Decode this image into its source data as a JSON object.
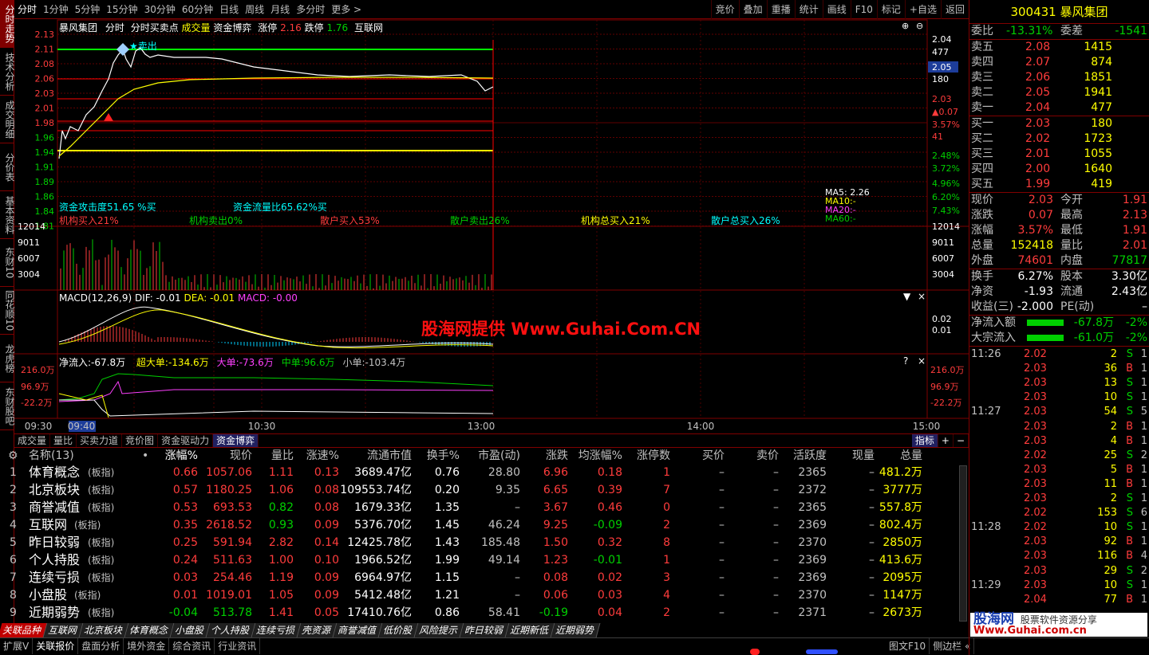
{
  "left_tabs": [
    "分时走势",
    "技术分析",
    "成交明细",
    "分价表",
    "基本资料",
    "东财10",
    "同花顺10",
    "龙虎榜",
    "东财股吧"
  ],
  "top_periods": [
    "分时",
    "1分钟",
    "5分钟",
    "15分钟",
    "30分钟",
    "60分钟",
    "日线",
    "周线",
    "月线",
    "多分时",
    "更多 >"
  ],
  "top_tools": [
    "竞价",
    "叠加",
    "重播",
    "统计",
    "画线",
    "F10",
    "标记",
    "+自选",
    "返回"
  ],
  "chart": {
    "header": {
      "name": "暴风集团",
      "items": [
        "分时",
        "分时买卖点",
        "成交量",
        "资金博弈"
      ],
      "zt_label": "涨停",
      "zt": "2.16",
      "dt_label": "跌停",
      "dt": "1.76",
      "industry": "互联网"
    },
    "y_left": [
      "2.13",
      "2.11",
      "2.08",
      "2.06",
      "2.03",
      "2.01",
      "1.98",
      "1.96",
      "1.94",
      "1.91",
      "1.89",
      "1.86",
      "1.84",
      "1.81"
    ],
    "y_right": [
      "2.04",
      "477",
      "2.05",
      "180",
      "2.03",
      "▲0.07",
      "3.57%",
      "41",
      "2.48%",
      "3.72%",
      "4.96%",
      "6.20%",
      "7.43%"
    ],
    "sell_tag": "卖出",
    "flow_text1": "资金攻击度51.65 %买",
    "flow_text2": "资金流量比65.62%买",
    "inst": [
      {
        "t": "机构买入21%",
        "c": "#ff3c3c"
      },
      {
        "t": "机构卖出0%",
        "c": "#00d000"
      },
      {
        "t": "散户买入53%",
        "c": "#ff3c3c"
      },
      {
        "t": "散户卖出26%",
        "c": "#00d000"
      },
      {
        "t": "机构总买入21%",
        "c": "#ffff00"
      },
      {
        "t": "散户总买入26%",
        "c": "#00ffff"
      }
    ],
    "ma": {
      "ma5": "MA5:  2.26",
      "ma10": "MA10:-",
      "ma20": "MA20:-",
      "ma60": "MA60:-"
    },
    "vol_y": [
      "12014",
      "9011",
      "6007",
      "3004"
    ],
    "macd_label": "MACD(12,26,9)",
    "dif": "DIF: -0.01",
    "dea": "DEA: -0.01",
    "macd": "MACD: -0.00",
    "macd_y": [
      "0.02",
      "0.01"
    ],
    "flow_label": "净流入:-67.8万",
    "flow_items": [
      {
        "t": "超大单:-134.6万",
        "c": "#ffff00"
      },
      {
        "t": "大单:-73.6万",
        "c": "#ff40ff"
      },
      {
        "t": "中单:96.6万",
        "c": "#00d000"
      },
      {
        "t": "小单:-103.4万",
        "c": "#c0c0c0"
      }
    ],
    "flow_y": [
      "216.0万",
      "96.9万",
      "-22.2万"
    ],
    "time_axis": [
      "09:30",
      "09:40",
      "10:30",
      "13:00",
      "14:00",
      "15:00"
    ],
    "watermark": "股海网提供 Www.Guhai.Com.CN"
  },
  "sub_tabs": [
    "成交量",
    "量比",
    "买卖力道",
    "竞价图",
    "资金驱动力",
    "资金博弈"
  ],
  "sub_tabs_right": [
    "指标",
    "+",
    "−"
  ],
  "table": {
    "headers": [
      "名称(13)",
      "•",
      "涨幅%",
      "现价",
      "量比",
      "涨速%",
      "流通市值",
      "换手%",
      "市盈(动)",
      "涨跌",
      "均涨幅%",
      "涨停数",
      "买价",
      "卖价",
      "活跃度",
      "现量",
      "总量"
    ],
    "rows": [
      [
        "1",
        "体育概念",
        "(板指)",
        "0.66",
        "1057.06",
        "1.11",
        "0.13",
        "3689.47亿",
        "0.76",
        "28.80",
        "6.96",
        "0.18",
        "1",
        "–",
        "–",
        "2365",
        "–",
        "481.2万"
      ],
      [
        "2",
        "北京板块",
        "(板指)",
        "0.57",
        "1180.25",
        "1.06",
        "0.08",
        "109553.74亿",
        "0.20",
        "9.35",
        "6.65",
        "0.39",
        "7",
        "–",
        "–",
        "2372",
        "–",
        "3777万"
      ],
      [
        "3",
        "商誉减值",
        "(板指)",
        "0.53",
        "693.53",
        "0.82",
        "0.08",
        "1679.33亿",
        "1.35",
        "–",
        "3.67",
        "0.46",
        "0",
        "–",
        "–",
        "2365",
        "–",
        "557.8万"
      ],
      [
        "4",
        "互联网",
        "(板指)",
        "0.35",
        "2618.52",
        "0.93",
        "0.09",
        "5376.70亿",
        "1.45",
        "46.24",
        "9.25",
        "-0.09",
        "2",
        "–",
        "–",
        "2369",
        "–",
        "802.4万"
      ],
      [
        "5",
        "昨日较弱",
        "(板指)",
        "0.25",
        "591.94",
        "2.82",
        "0.14",
        "12425.78亿",
        "1.43",
        "185.48",
        "1.50",
        "0.32",
        "8",
        "–",
        "–",
        "2370",
        "–",
        "2850万"
      ],
      [
        "6",
        "个人持股",
        "(板指)",
        "0.24",
        "511.63",
        "1.00",
        "0.10",
        "1966.52亿",
        "1.99",
        "49.14",
        "1.23",
        "-0.01",
        "1",
        "–",
        "–",
        "2369",
        "–",
        "413.6万"
      ],
      [
        "7",
        "连续亏损",
        "(板指)",
        "0.03",
        "254.46",
        "1.19",
        "0.09",
        "6964.97亿",
        "1.15",
        "–",
        "0.08",
        "0.02",
        "3",
        "–",
        "–",
        "2369",
        "–",
        "2095万"
      ],
      [
        "8",
        "小盘股",
        "(板指)",
        "0.01",
        "1019.01",
        "1.05",
        "0.09",
        "5412.48亿",
        "1.21",
        "–",
        "0.06",
        "0.03",
        "4",
        "–",
        "–",
        "2370",
        "–",
        "1147万"
      ],
      [
        "9",
        "近期弱势",
        "(板指)",
        "-0.04",
        "513.78",
        "1.41",
        "0.05",
        "17410.76亿",
        "0.86",
        "58.41",
        "-0.19",
        "0.04",
        "2",
        "–",
        "–",
        "2371",
        "–",
        "2673万"
      ]
    ]
  },
  "bottom_tabs": [
    "关联品种",
    "互联网",
    "北京板块",
    "体育概念",
    "小盘股",
    "个人持股",
    "连续亏损",
    "壳资源",
    "商誉减值",
    "低价股",
    "风险提示",
    "昨日较弱",
    "近期新低",
    "近期弱势"
  ],
  "status_bar": [
    "扩展V",
    "关联报价",
    "盘面分析",
    "境外资金",
    "综合资讯",
    "行业资讯"
  ],
  "status_right": [
    "图文F10",
    "侧边栏 «"
  ],
  "right": {
    "code": "300431",
    "name": "暴风集团",
    "wb": {
      "l1": "委比",
      "v1": "-13.31%",
      "l2": "委差",
      "v2": "-1541"
    },
    "asks": [
      [
        "卖五",
        "2.08",
        "1415"
      ],
      [
        "卖四",
        "2.07",
        "874"
      ],
      [
        "卖三",
        "2.06",
        "1851"
      ],
      [
        "卖二",
        "2.05",
        "1941"
      ],
      [
        "卖一",
        "2.04",
        "477"
      ]
    ],
    "bids": [
      [
        "买一",
        "2.03",
        "180"
      ],
      [
        "买二",
        "2.02",
        "1723"
      ],
      [
        "买三",
        "2.01",
        "1055"
      ],
      [
        "买四",
        "2.00",
        "1640"
      ],
      [
        "买五",
        "1.99",
        "419"
      ]
    ],
    "stats": [
      [
        "现价",
        "2.03",
        "今开",
        "1.91"
      ],
      [
        "涨跌",
        "0.07",
        "最高",
        "2.13"
      ],
      [
        "涨幅",
        "3.57%",
        "最低",
        "1.91"
      ],
      [
        "总量",
        "152418",
        "量比",
        "2.01"
      ],
      [
        "外盘",
        "74601",
        "内盘",
        "77817"
      ]
    ],
    "stats2": [
      [
        "换手",
        "6.27%",
        "股本",
        "3.30亿"
      ],
      [
        "净资",
        "-1.93",
        "流通",
        "2.43亿"
      ],
      [
        "收益(三)",
        "-2.000",
        "PE(动)",
        "–"
      ]
    ],
    "flows": [
      [
        "净流入额",
        "-67.8万",
        "-2%"
      ],
      [
        "大宗流入",
        "-61.0万",
        "-2%"
      ]
    ],
    "ticks": [
      {
        "time": "11:26",
        "p": "2.02",
        "v": "2",
        "d": "S",
        "n": "1"
      },
      {
        "p": "2.03",
        "v": "36",
        "d": "B",
        "n": "1"
      },
      {
        "p": "2.03",
        "v": "13",
        "d": "S",
        "n": "1"
      },
      {
        "p": "2.03",
        "v": "10",
        "d": "S",
        "n": "1"
      },
      {
        "time": "11:27",
        "p": "2.03",
        "v": "54",
        "d": "S",
        "n": "5"
      },
      {
        "p": "2.03",
        "v": "2",
        "d": "B",
        "n": "1"
      },
      {
        "p": "2.03",
        "v": "4",
        "d": "B",
        "n": "1"
      },
      {
        "p": "2.02",
        "v": "25",
        "d": "S",
        "n": "2"
      },
      {
        "p": "2.03",
        "v": "5",
        "d": "B",
        "n": "1"
      },
      {
        "p": "2.03",
        "v": "11",
        "d": "B",
        "n": "1"
      },
      {
        "p": "2.03",
        "v": "2",
        "d": "S",
        "n": "1"
      },
      {
        "p": "2.02",
        "v": "153",
        "d": "S",
        "n": "6"
      },
      {
        "time": "11:28",
        "p": "2.02",
        "v": "10",
        "d": "S",
        "n": "1"
      },
      {
        "p": "2.03",
        "v": "92",
        "d": "B",
        "n": "1"
      },
      {
        "p": "2.03",
        "v": "116",
        "d": "B",
        "n": "4"
      },
      {
        "p": "2.03",
        "v": "29",
        "d": "S",
        "n": "2"
      },
      {
        "time": "11:29",
        "p": "2.03",
        "v": "10",
        "d": "S",
        "n": "1"
      },
      {
        "p": "2.04",
        "v": "77",
        "d": "B",
        "n": "1"
      }
    ],
    "logo1": "股海网",
    "logo2": "股票软件资源分享",
    "logo3": "Www.Guhai.com.cn"
  }
}
